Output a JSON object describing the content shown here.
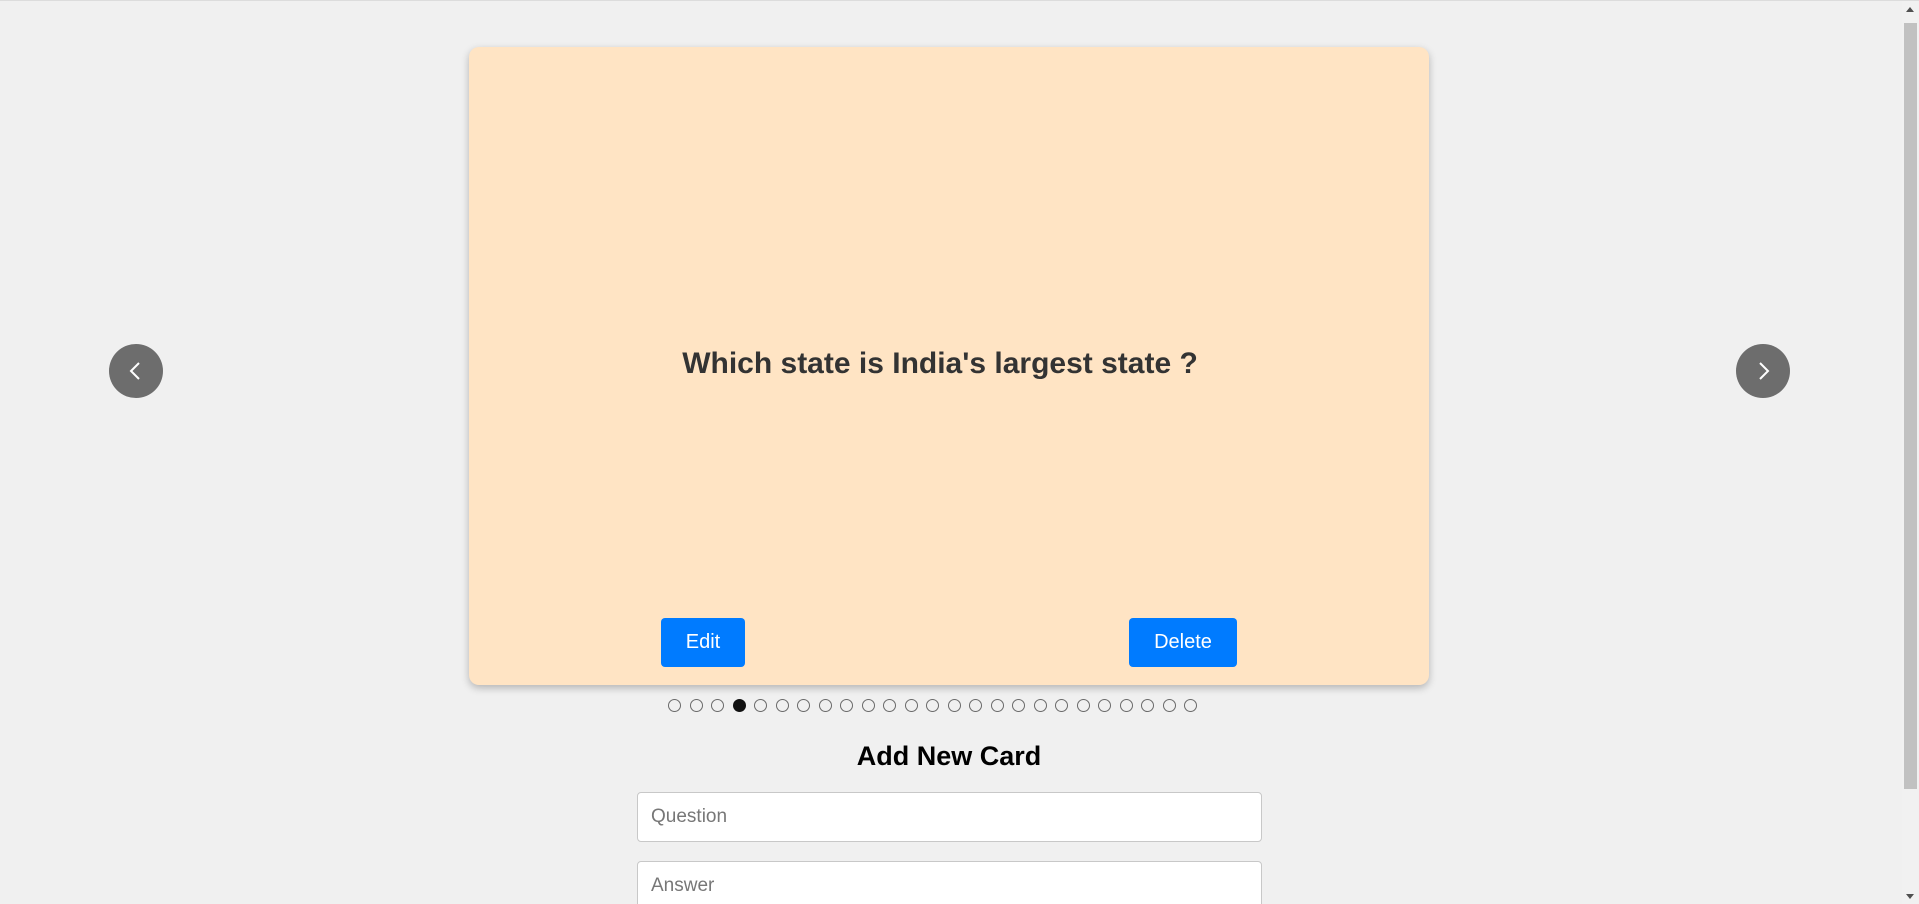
{
  "card": {
    "question": "Which state is India's largest state ?",
    "background_color": "#ffe4c4",
    "edit_label": "Edit",
    "delete_label": "Delete"
  },
  "navigation": {
    "prev_icon": "chevron-left-icon",
    "next_icon": "chevron-right-icon"
  },
  "pagination": {
    "total_cards": 25,
    "active_index": 3
  },
  "form": {
    "title": "Add New Card",
    "question_placeholder": "Question",
    "answer_placeholder": "Answer",
    "question_value": "",
    "answer_value": ""
  },
  "colors": {
    "page_background": "#f0f0f0",
    "button_primary": "#007bff",
    "nav_button": "#6d6d6d",
    "text_dark": "#333333"
  }
}
